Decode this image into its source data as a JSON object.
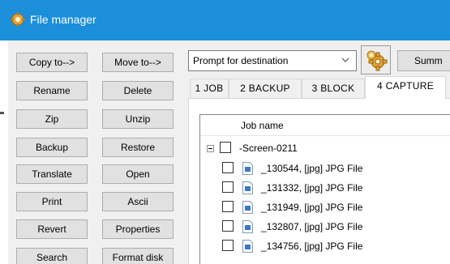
{
  "window": {
    "title": "File manager"
  },
  "buttons": {
    "copy_to": "Copy to-->",
    "move_to": "Move to-->",
    "rename": "Rename",
    "delete": "Delete",
    "zip": "Zip",
    "unzip": "Unzip",
    "backup": "Backup",
    "restore": "Restore",
    "translate": "Translate",
    "open": "Open",
    "print": "Print",
    "ascii": "Ascii",
    "revert": "Revert",
    "properties": "Properties",
    "search": "Search",
    "format_disk": "Format disk"
  },
  "destination": {
    "value": "Prompt for destination"
  },
  "summary_button": {
    "label": "Summ"
  },
  "tabs": [
    {
      "label": "1 JOB"
    },
    {
      "label": "2 BACKUP"
    },
    {
      "label": "3 BLOCK"
    },
    {
      "label": "4 CAPTURE"
    }
  ],
  "active_tab": "4 CAPTURE",
  "tree": {
    "column_header": "Job name",
    "group": {
      "label": "-Screen-0211"
    },
    "files": [
      {
        "label": "_130544, [jpg] JPG File"
      },
      {
        "label": "_131332, [jpg] JPG File"
      },
      {
        "label": "_131949, [jpg] JPG File"
      },
      {
        "label": "_132807, [jpg] JPG File"
      },
      {
        "label": "_134756, [jpg] JPG File"
      }
    ]
  },
  "colors": {
    "titlebar": "#1b8fd9",
    "panel": "#f0f0f0",
    "button_face": "#e1e1e1"
  },
  "icons": [
    "file-manager-gear-icon",
    "dropdown-arrow-icon",
    "gear-icon",
    "collapse-icon",
    "checkbox-icon",
    "image-file-icon"
  ]
}
